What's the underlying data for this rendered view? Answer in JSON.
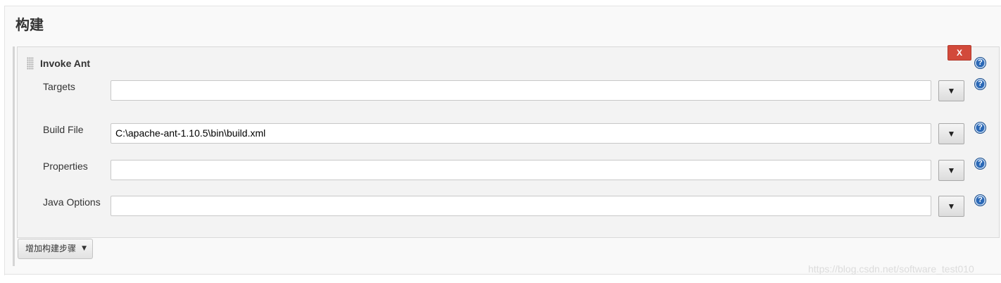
{
  "section": {
    "title": "构建"
  },
  "step": {
    "title": "Invoke Ant",
    "delete_label": "X",
    "help_glyph": "?",
    "fields": [
      {
        "label": "Targets",
        "value": "",
        "expand_glyph": "▼"
      },
      {
        "label": "Build File",
        "value": "C:\\apache-ant-1.10.5\\bin\\build.xml",
        "expand_glyph": "▼"
      },
      {
        "label": "Properties",
        "value": "",
        "expand_glyph": "▼"
      },
      {
        "label": "Java Options",
        "value": "",
        "expand_glyph": "▼"
      }
    ]
  },
  "add_step": {
    "label": "增加构建步骤",
    "caret": "▼"
  },
  "watermark": "https://blog.csdn.net/software_test010",
  "colors": {
    "delete": "#d24a3b",
    "help": "#2a68b6"
  },
  "icons": [
    "drag-handle-icon",
    "help-icon",
    "dropdown-arrow-icon"
  ]
}
